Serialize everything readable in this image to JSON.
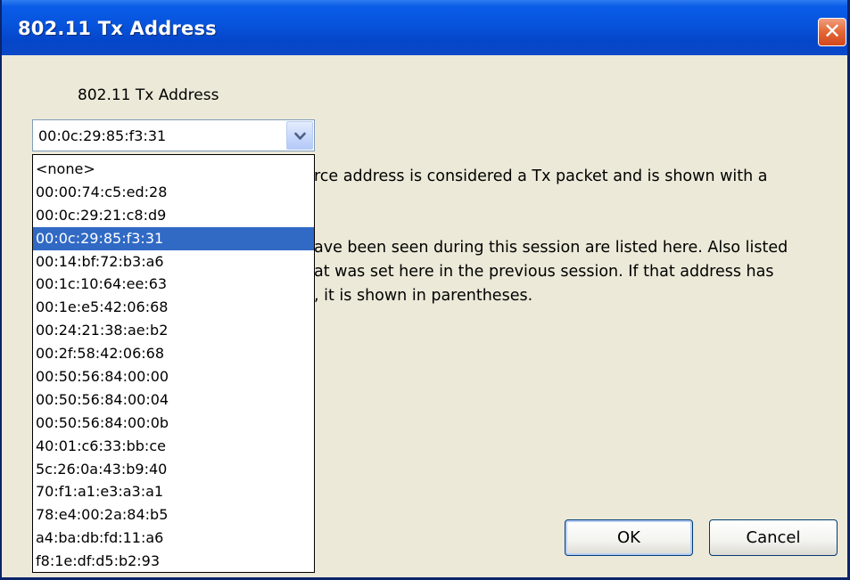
{
  "window": {
    "title": "802.11 Tx Address",
    "close_glyph": "✕"
  },
  "form": {
    "label": "802.11 Tx Address",
    "selected_value": "00:0c:29:85:f3:31",
    "dropdown_icon": "chevron-down-icon",
    "options": [
      "<none>",
      "00:00:74:c5:ed:28",
      "00:0c:29:21:c8:d9",
      "00:0c:29:85:f3:31",
      "00:14:bf:72:b3:a6",
      "00:1c:10:64:ee:63",
      "00:1e:e5:42:06:68",
      "00:24:21:38:ae:b2",
      "00:2f:58:42:06:68",
      "00:50:56:84:00:00",
      "00:50:56:84:00:04",
      "00:50:56:84:00:0b",
      "40:01:c6:33:bb:ce",
      "5c:26:0a:43:b9:40",
      "70:f1:a1:e3:a3:a1",
      "78:e4:00:2a:84:b5",
      "a4:ba:db:fd:11:a6",
      "f8:1e:df:d5:b2:93"
    ],
    "selected_index": 3
  },
  "description": {
    "line1": "rce address is considered a Tx packet and is shown with a",
    "line2": "ave been seen during this session are listed here.  Also listed",
    "line3": "at was set here in the previous session.  If that address has",
    "line4": ", it is shown in parentheses."
  },
  "buttons": {
    "ok": "OK",
    "cancel": "Cancel"
  },
  "colors": {
    "titlebar": "#0753dc",
    "selection": "#316ac5",
    "dialog_bg": "#ece9d8",
    "close_button": "#d2481c"
  }
}
